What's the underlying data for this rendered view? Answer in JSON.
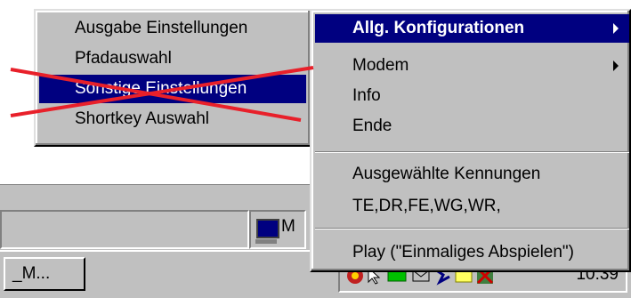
{
  "submenu": {
    "items": [
      {
        "label": "Ausgabe Einstellungen"
      },
      {
        "label": "Pfadauswahl"
      },
      {
        "label": "Sonstige Einstellungen",
        "selected": true
      },
      {
        "label": "Shortkey Auswahl"
      }
    ]
  },
  "mainmenu": {
    "items": [
      {
        "label": "Allg. Konfigurationen",
        "selected": true,
        "has_submenu": true
      },
      {
        "label": "Modem",
        "has_submenu": true
      },
      {
        "label": "Info"
      },
      {
        "label": "Ende"
      }
    ],
    "kennungen_label": "Ausgewählte Kennungen",
    "kennungen_value": "TE,DR,FE,WG,WR,",
    "play_label": "Play (\"Einmaliges Abspielen\")"
  },
  "statusbar": {
    "field2_text": "M"
  },
  "taskbar": {
    "task_button_label": "_M...",
    "clock": "10:39"
  },
  "colors": {
    "selection": "#000080",
    "cross": "#e8202a",
    "face": "#c0c0c0"
  }
}
